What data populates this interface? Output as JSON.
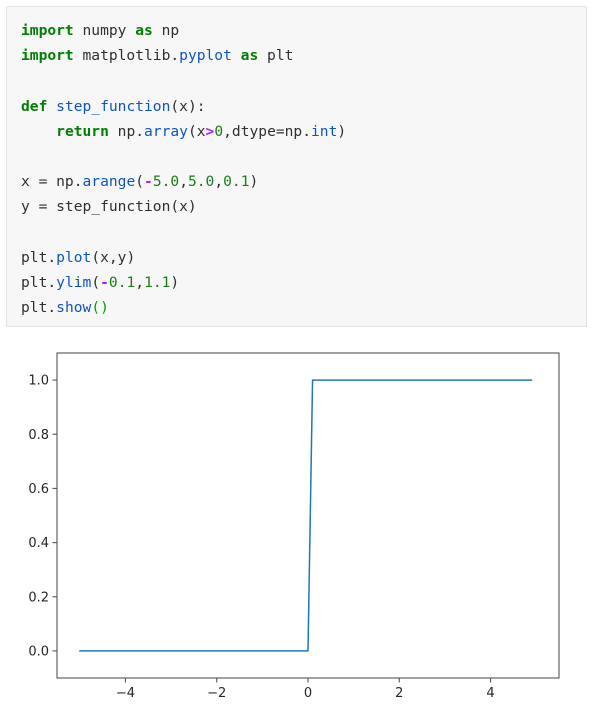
{
  "code_cell": {
    "language": "python",
    "background": "#f7f7f7",
    "lines": [
      [
        {
          "t": "import",
          "c": "kw"
        },
        {
          "t": " numpy ",
          "c": "pl"
        },
        {
          "t": "as",
          "c": "kw"
        },
        {
          "t": " np",
          "c": "pl"
        }
      ],
      [
        {
          "t": "import",
          "c": "kw"
        },
        {
          "t": " matplotlib.",
          "c": "pl"
        },
        {
          "t": "pyplot",
          "c": "fn"
        },
        {
          "t": " ",
          "c": "pl"
        },
        {
          "t": "as",
          "c": "kw"
        },
        {
          "t": " plt",
          "c": "pl"
        }
      ],
      [],
      [
        {
          "t": "def",
          "c": "kw"
        },
        {
          "t": " ",
          "c": "pl"
        },
        {
          "t": "step_function",
          "c": "fn"
        },
        {
          "t": "(x):",
          "c": "pl"
        }
      ],
      [
        {
          "t": "    ",
          "c": "pl"
        },
        {
          "t": "return",
          "c": "kw"
        },
        {
          "t": " np.",
          "c": "pl"
        },
        {
          "t": "array",
          "c": "fn"
        },
        {
          "t": "(x",
          "c": "pl"
        },
        {
          "t": ">",
          "c": "op"
        },
        {
          "t": "0",
          "c": "num"
        },
        {
          "t": ",dtype=np.",
          "c": "pl"
        },
        {
          "t": "int",
          "c": "fn"
        },
        {
          "t": ")",
          "c": "pl"
        }
      ],
      [],
      [
        {
          "t": "x = np.",
          "c": "pl"
        },
        {
          "t": "arange",
          "c": "fn"
        },
        {
          "t": "(",
          "c": "pl"
        },
        {
          "t": "-",
          "c": "op"
        },
        {
          "t": "5.0",
          "c": "num"
        },
        {
          "t": ",",
          "c": "pl"
        },
        {
          "t": "5.0",
          "c": "num"
        },
        {
          "t": ",",
          "c": "pl"
        },
        {
          "t": "0.1",
          "c": "num"
        },
        {
          "t": ")",
          "c": "pl"
        }
      ],
      [
        {
          "t": "y = step_function(x)",
          "c": "pl"
        }
      ],
      [],
      [
        {
          "t": "plt.",
          "c": "pl"
        },
        {
          "t": "plot",
          "c": "fn"
        },
        {
          "t": "(x,y)",
          "c": "pl"
        }
      ],
      [
        {
          "t": "plt.",
          "c": "pl"
        },
        {
          "t": "ylim",
          "c": "fn"
        },
        {
          "t": "(",
          "c": "pl"
        },
        {
          "t": "-",
          "c": "op"
        },
        {
          "t": "0.1",
          "c": "num"
        },
        {
          "t": ",",
          "c": "pl"
        },
        {
          "t": "1.1",
          "c": "num"
        },
        {
          "t": ")",
          "c": "pl"
        }
      ],
      [
        {
          "t": "plt.",
          "c": "pl"
        },
        {
          "t": "show",
          "c": "fn"
        },
        {
          "t": "()",
          "c": "pn"
        }
      ]
    ],
    "plain_text": "import numpy as np\nimport matplotlib.pyplot as plt\n\ndef step_function(x):\n    return np.array(x>0,dtype=np.int)\n\nx = np.arange(-5.0,5.0,0.1)\ny = step_function(x)\n\nplt.plot(x,y)\nplt.ylim(-0.1,1.1)\nplt.show()"
  },
  "chart_data": {
    "type": "line",
    "title": "",
    "xlabel": "",
    "ylabel": "",
    "xlim": [
      -5.5,
      5.5
    ],
    "ylim": [
      -0.1,
      1.1
    ],
    "grid": false,
    "legend": false,
    "line_color": "#1f77b4",
    "line_width": 1.5,
    "xticks": [
      -4,
      -2,
      0,
      2,
      4
    ],
    "xticklabels": [
      "−4",
      "−2",
      "0",
      "2",
      "4"
    ],
    "yticks": [
      0.0,
      0.2,
      0.4,
      0.6,
      0.8,
      1.0
    ],
    "yticklabels": [
      "0.0",
      "0.2",
      "0.4",
      "0.6",
      "0.8",
      "1.0"
    ],
    "series": [
      {
        "name": "step_function(x)",
        "x": [
          -5.0,
          -4.9,
          -4.8,
          -4.7,
          -4.6,
          -4.5,
          -4.4,
          -4.3,
          -4.2,
          -4.1,
          -4.0,
          -3.9,
          -3.8,
          -3.7,
          -3.6,
          -3.5,
          -3.4,
          -3.3,
          -3.2,
          -3.1,
          -3.0,
          -2.9,
          -2.8,
          -2.7,
          -2.6,
          -2.5,
          -2.4,
          -2.3,
          -2.2,
          -2.1,
          -2.0,
          -1.9,
          -1.8,
          -1.7,
          -1.6,
          -1.5,
          -1.4,
          -1.3,
          -1.2,
          -1.1,
          -1.0,
          -0.9,
          -0.8,
          -0.7,
          -0.6,
          -0.5,
          -0.4,
          -0.3,
          -0.2,
          -0.1,
          0.0,
          0.1,
          0.2,
          0.3,
          0.4,
          0.5,
          0.6,
          0.7,
          0.8,
          0.9,
          1.0,
          1.1,
          1.2,
          1.3,
          1.4,
          1.5,
          1.6,
          1.7,
          1.8,
          1.9,
          2.0,
          2.1,
          2.2,
          2.3,
          2.4,
          2.5,
          2.6,
          2.7,
          2.8,
          2.9,
          3.0,
          3.1,
          3.2,
          3.3,
          3.4,
          3.5,
          3.6,
          3.7,
          3.8,
          3.9,
          4.0,
          4.1,
          4.2,
          4.3,
          4.4,
          4.5,
          4.6,
          4.7,
          4.8,
          4.9
        ],
        "y": [
          0,
          0,
          0,
          0,
          0,
          0,
          0,
          0,
          0,
          0,
          0,
          0,
          0,
          0,
          0,
          0,
          0,
          0,
          0,
          0,
          0,
          0,
          0,
          0,
          0,
          0,
          0,
          0,
          0,
          0,
          0,
          0,
          0,
          0,
          0,
          0,
          0,
          0,
          0,
          0,
          0,
          0,
          0,
          0,
          0,
          0,
          0,
          0,
          0,
          0,
          0,
          1,
          1,
          1,
          1,
          1,
          1,
          1,
          1,
          1,
          1,
          1,
          1,
          1,
          1,
          1,
          1,
          1,
          1,
          1,
          1,
          1,
          1,
          1,
          1,
          1,
          1,
          1,
          1,
          1,
          1,
          1,
          1,
          1,
          1,
          1,
          1,
          1,
          1,
          1,
          1,
          1,
          1,
          1,
          1,
          1,
          1,
          1,
          1,
          1
        ]
      }
    ]
  }
}
